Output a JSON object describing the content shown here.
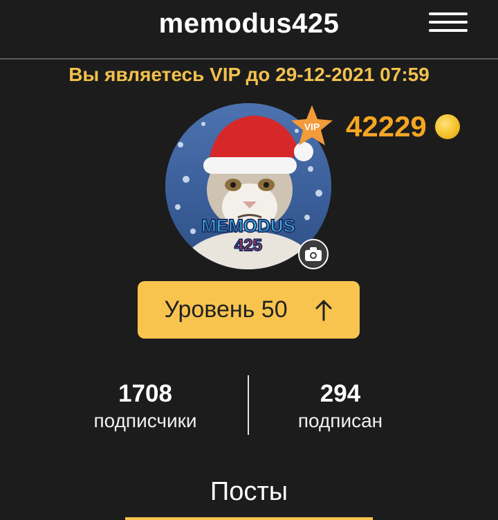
{
  "header": {
    "username": "memodus425",
    "menu_icon": "hamburger-menu-icon"
  },
  "profile": {
    "vip_status": "Вы являетесь VIP до 29-12-2021 07:59",
    "vip_badge": "VIP",
    "coins": "42229",
    "coin_icon": "coin-icon",
    "avatar_text_line1": "MEMODUS",
    "avatar_text_line2": "425",
    "camera_icon": "camera-icon",
    "level_label": "Уровень 50",
    "level_icon": "arrow-up-icon"
  },
  "stats": {
    "followers": {
      "count": "1708",
      "label": "подписчики"
    },
    "following": {
      "count": "294",
      "label": "подписан"
    }
  },
  "tabs": {
    "posts": "Посты"
  },
  "colors": {
    "background": "#1c1c1c",
    "accent": "#f8c44e",
    "vip_text": "#f2c14e",
    "coins_text": "#f5a623"
  }
}
